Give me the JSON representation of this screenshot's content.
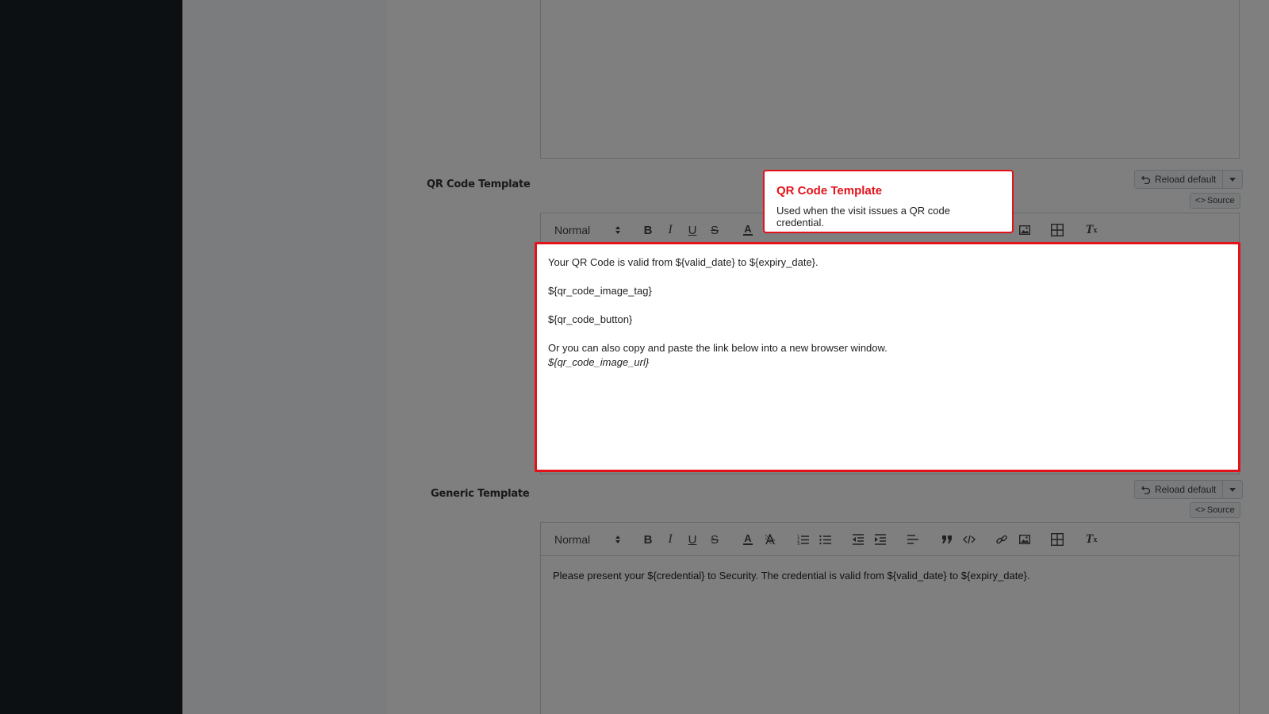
{
  "sections": {
    "qr": {
      "label": "QR Code Template"
    },
    "generic": {
      "label": "Generic Template"
    }
  },
  "controls": {
    "reload_label": "Reload default",
    "source_label": "Source",
    "source_prefix": "<>"
  },
  "toolbar": {
    "format_selected": "Normal",
    "icons": [
      "bold-icon",
      "italic-icon",
      "underline-icon",
      "strikethrough-icon",
      "font-color-icon",
      "background-color-icon",
      "ordered-list-icon",
      "bullet-list-icon",
      "outdent-icon",
      "indent-icon",
      "align-icon",
      "blockquote-icon",
      "code-block-icon",
      "link-icon",
      "image-icon",
      "table-icon",
      "clear-format-icon"
    ]
  },
  "qr_editor": {
    "line1": "Your QR Code is valid from ${valid_date} to ${expiry_date}.",
    "line2": "${qr_code_image_tag}",
    "line3": "${qr_code_button}",
    "line4": "Or you can also copy and paste the link below into a new browser window.",
    "line5": "${qr_code_image_url}"
  },
  "generic_editor": {
    "line1": "Please present your ${credential} to Security. The credential is valid from ${valid_date} to ${expiry_date}."
  },
  "tooltip": {
    "title": "QR Code Template",
    "body": "Used when the visit issues a QR code credential."
  },
  "colors": {
    "highlight": "#e3121a",
    "sidebar": "#1b2127"
  }
}
